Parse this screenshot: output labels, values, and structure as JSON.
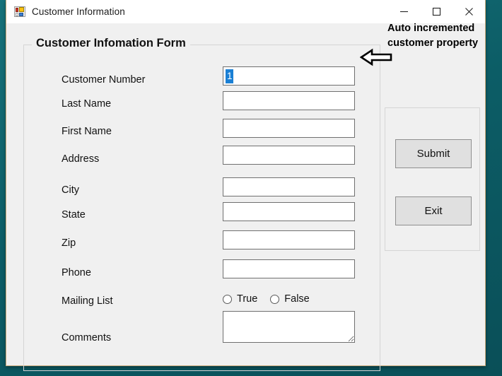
{
  "window": {
    "title": "Customer Information",
    "icon": "winforms-app-icon",
    "controls": [
      {
        "name": "minimize-button",
        "glyph": "minimize-icon"
      },
      {
        "name": "maximize-button",
        "glyph": "maximize-icon"
      },
      {
        "name": "close-button",
        "glyph": "close-icon"
      }
    ]
  },
  "form": {
    "group_title": "Customer Infomation Form",
    "fields": [
      {
        "label": "Customer Number",
        "value": "1",
        "placeholder": "",
        "focused": true,
        "multiline": false
      },
      {
        "label": "Last Name",
        "value": "",
        "placeholder": "",
        "focused": false,
        "multiline": false
      },
      {
        "label": "First Name",
        "value": "",
        "placeholder": "",
        "focused": false,
        "multiline": false
      },
      {
        "label": "Address",
        "value": "",
        "placeholder": "",
        "focused": false,
        "multiline": false
      },
      {
        "label": "City",
        "value": "",
        "placeholder": "",
        "focused": false,
        "multiline": false
      },
      {
        "label": "State",
        "value": "",
        "placeholder": "",
        "focused": false,
        "multiline": false
      },
      {
        "label": "Zip",
        "value": "",
        "placeholder": "",
        "focused": false,
        "multiline": false
      },
      {
        "label": "Phone",
        "value": "",
        "placeholder": "",
        "focused": false,
        "multiline": false
      },
      {
        "label": "Mailing List",
        "value": "",
        "placeholder": "",
        "focused": false,
        "multiline": false
      },
      {
        "label": "Comments",
        "value": "",
        "placeholder": "",
        "focused": false,
        "multiline": true
      }
    ],
    "mailing_list": {
      "label": "Mailing List",
      "options": [
        {
          "label": "True",
          "selected": false
        },
        {
          "label": "False",
          "selected": false
        }
      ]
    }
  },
  "buttons": {
    "submit_label": "Submit",
    "exit_label": "Exit"
  },
  "annotation": {
    "line1": "Auto incremented",
    "line2": "customer property",
    "arrow": "left-arrow-icon"
  },
  "colors": {
    "desktop": "#0d6a72",
    "window_background": "#f0f0f0",
    "titlebar": "#ffffff",
    "selection_highlight": "#1a7fd4",
    "button_face": "#e0e0e0",
    "textbox_border": "#707070",
    "groupbox_border": "#d5d5d5"
  }
}
